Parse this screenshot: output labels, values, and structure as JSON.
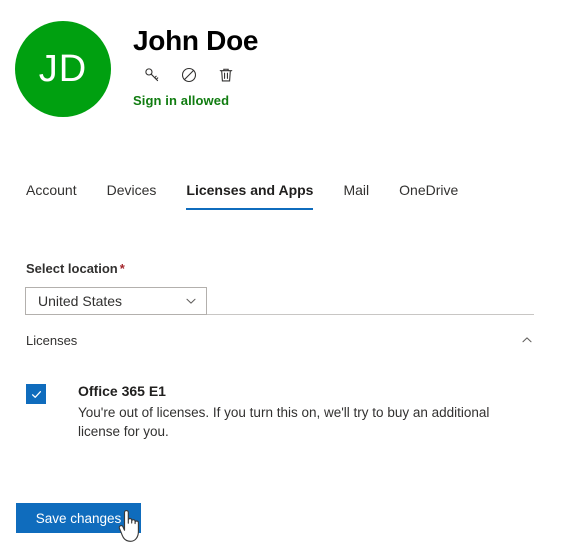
{
  "header": {
    "avatar_initials": "JD",
    "avatar_color": "#00a010",
    "user_name": "John Doe",
    "signin_status": "Sign in allowed",
    "signin_status_color": "#107c10",
    "actions": [
      {
        "icon": "key-icon",
        "label": "Reset password"
      },
      {
        "icon": "block-icon",
        "label": "Block sign-in"
      },
      {
        "icon": "trash-icon",
        "label": "Delete user"
      }
    ]
  },
  "tabs": [
    {
      "label": "Account",
      "active": false
    },
    {
      "label": "Devices",
      "active": false
    },
    {
      "label": "Licenses and Apps",
      "active": true
    },
    {
      "label": "Mail",
      "active": false
    },
    {
      "label": "OneDrive",
      "active": false
    }
  ],
  "accent_color": "#0f6cbd",
  "location": {
    "label": "Select location",
    "required_marker": "*",
    "selected": "United States"
  },
  "licenses_section": {
    "title": "Licenses",
    "expanded": true,
    "collapse_icon": "chevron-up-icon",
    "items": [
      {
        "name": "Office 365 E1",
        "checked": true,
        "description": "You're out of licenses. If you turn this on, we'll try to buy an additional license for you."
      }
    ]
  },
  "footer": {
    "save_label": "Save changes"
  }
}
